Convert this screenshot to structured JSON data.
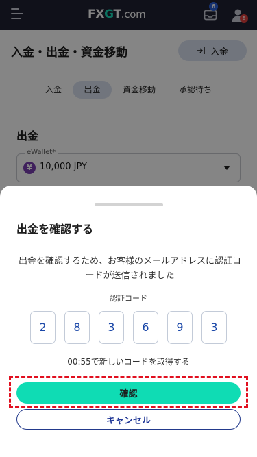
{
  "header": {
    "logo_fx": "FX",
    "logo_g": "G",
    "logo_t": "T",
    "logo_domain": ".com",
    "notification_count": "6",
    "alert_badge": "!",
    "icons": [
      "menu-icon",
      "inbox-icon",
      "user-icon"
    ]
  },
  "page": {
    "title": "入金・出金・資金移動",
    "deposit_button_label": "入金",
    "tabs": [
      {
        "label": "入金",
        "active": false
      },
      {
        "label": "出金",
        "active": true
      },
      {
        "label": "資金移動",
        "active": false
      },
      {
        "label": "承認待ち",
        "active": false
      }
    ],
    "section_title": "出金",
    "wallet": {
      "label": "eWallet*",
      "currency_symbol": "¥",
      "value": "10,000 JPY"
    }
  },
  "sheet": {
    "title": "出金を確認する",
    "message": "出金を確認するため、お客様のメールアドレスに認証コードが送信されました",
    "code_label": "認証コード",
    "code_digits": [
      "2",
      "8",
      "3",
      "6",
      "9",
      "3"
    ],
    "resend_text": "00:55で新しいコードを取得する",
    "confirm_label": "確認",
    "cancel_label": "キャンセル"
  },
  "colors": {
    "header_bg": "#1f2233",
    "accent_teal": "#0fdcb4",
    "tab_active_bg": "#d9e0ef",
    "code_text": "#1a47a8",
    "highlight_red": "#e10f1f",
    "cancel_border": "#233a8c"
  }
}
